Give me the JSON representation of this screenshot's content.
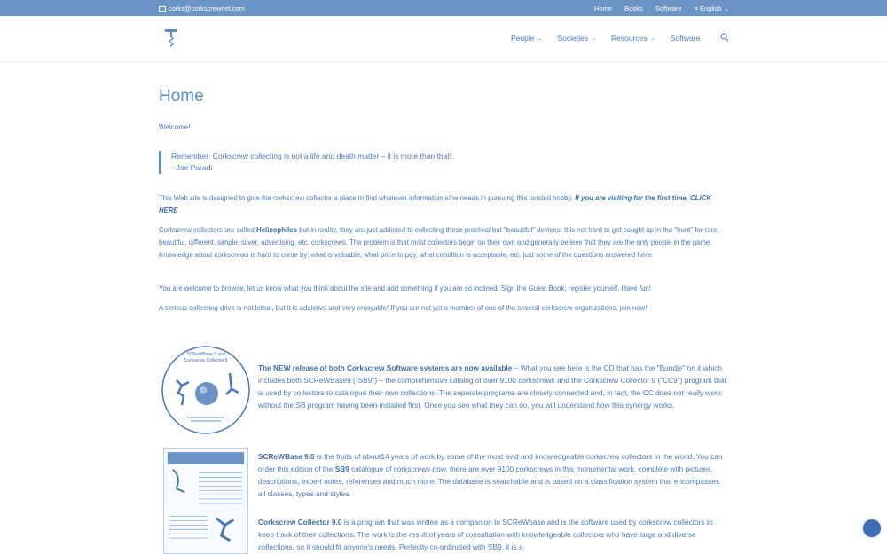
{
  "topbar": {
    "email": "corks@corkscrewnet.com",
    "links": [
      "Home",
      "Books",
      "Software",
      "English"
    ]
  },
  "nav": {
    "items": [
      "People",
      "Societies",
      "Resources",
      "Software"
    ]
  },
  "page": {
    "title": "Home",
    "welcome": "Welcome!",
    "quote_line1": "Remember: Corkscrew collecting is not a life and death matter – it is more than that!",
    "quote_line2": "--Joe Paradi",
    "p1_text": "This Web site is designed to give the corkscrew collector a place to find whatever information s/he needs in pursuing this twisted hobby.",
    "p1_link": "If you are visiting for the first time, CLICK HERE",
    "p2_pre": "Corkscrew collectors are called",
    "p2_bold": "Helixophiles",
    "p2_post": "but in reality, they are just addicted to collecting these practical but \"beautiful\" devices.  It is not hard to get caught up in the \"hunt\" for rare, beautiful, different, simple, silver, advertising, etc. corkscrews.  The problem is that most collectors begin on their own and generally believe that they are the only people in the game.  Knowledge about corkscrews is hard to come by; what is valuable, what price to pay, what condition is acceptable, etc. just some of the questions answered here.",
    "p3": "You are welcome to browse, let us know what you think about the site and add something if you are so inclined.  Sign the Guest Book, register yourself.  Have fun!",
    "p4": "A serious collecting drive is not lethal, but it is addictive and very enjoyable!   If you are not yet a member of one of the several corkscrew organizations, join now!"
  },
  "sections": {
    "s1_bold": "The NEW release of both Corkscrew Software systems are now available",
    "s1_text": "– What you see here is the CD that has the \"Bundle\" on it which includes both SCReWBase9 (\"SB9\") – the comprehensive catalog of over 9100 corkscrews and the Corkscrew Collector 9 (\"CC9\") program that is used by collectors to catalogue their own collections.  The separate programs are closely connected and, in fact, the CC does not really work without the SB program having been installed first.  Once you see what they can do, you will understand how this synergy works.",
    "s2_bold": "SCReWBase 9.0",
    "s2_text1": "is the fruits of about14 years of work by some of the most avid and knowledgeable corkscrew collectors in the world.  You can order this edition of the",
    "s2_bold2": "SB9",
    "s2_text2": "catalogue of corkscrews now, there are over 9100 corkscrews in this monumental work, complete with pictures, descriptions, expert notes, references and much more.  The database is searchable and is based on a classification system that encompasses all classes, types and styles.",
    "s3_bold": "Corkscrew Collector 9.0",
    "s3_text": "is a program that was written as a companion to SCReWbase and is the software used by corkscrew collectors to keep track of their collections.  The work is the result of years of consultation with knowledgeable collectors who have large and diverse collections, so it should fit anyone's needs.  Perfectly co-ordinated with SB9, it is a"
  },
  "cd": {
    "title_line1": "SCReWBase 9 and",
    "title_line2": "Corkscrew Collector 9"
  }
}
